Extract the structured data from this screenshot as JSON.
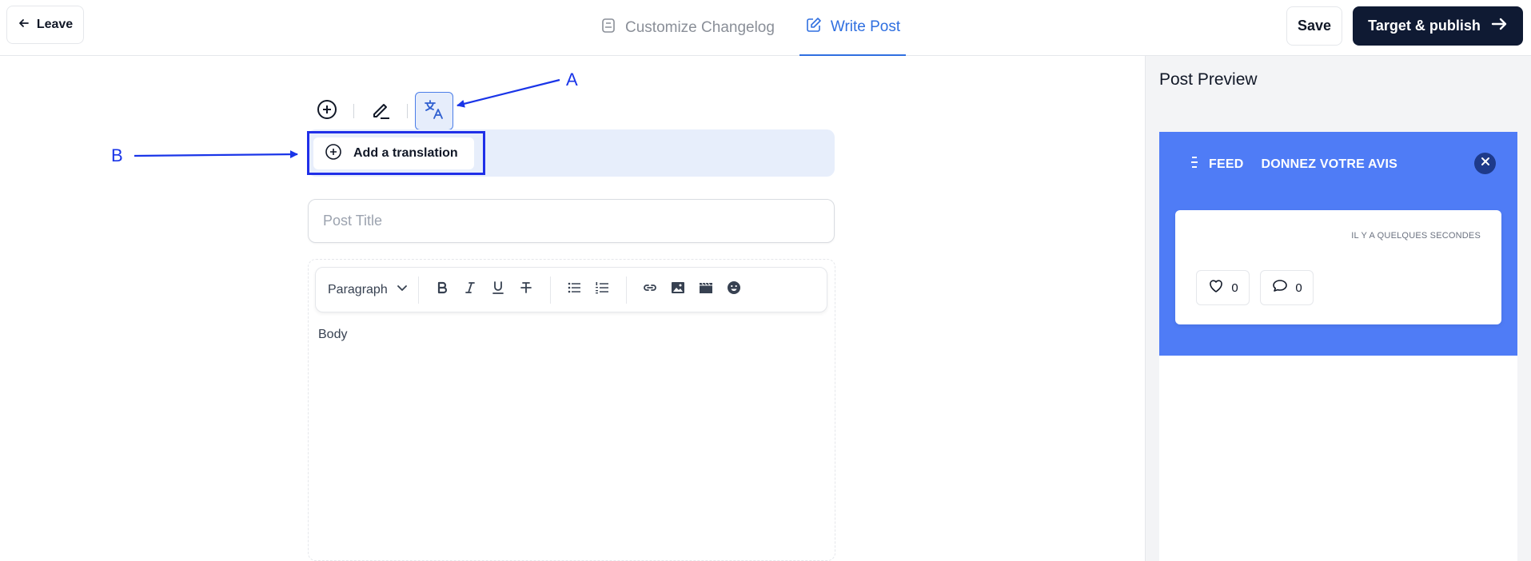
{
  "header": {
    "leave_label": "Leave",
    "tabs": [
      {
        "label": "Customize Changelog",
        "active": false
      },
      {
        "label": "Write Post",
        "active": true
      }
    ],
    "save_label": "Save",
    "publish_label": "Target & publish"
  },
  "editor": {
    "add_translation_label": "Add a translation",
    "title_placeholder": "Post Title",
    "paragraph_select": "Paragraph",
    "body_placeholder": "Body",
    "format_tools": [
      "bold-icon",
      "italic-icon",
      "underline-icon",
      "strikethrough-icon",
      "bullet-list-icon",
      "numbered-list-icon",
      "link-icon",
      "image-icon",
      "video-icon",
      "emoji-icon"
    ]
  },
  "annotations": {
    "a": "A",
    "b": "B",
    "color": "#1a35e8"
  },
  "preview": {
    "title": "Post Preview",
    "nav_feed": "FEED",
    "nav_feedback": "DONNEZ VOTRE AVIS",
    "post_time": "IL Y A QUELQUES SECONDES",
    "likes": "0",
    "comments": "0",
    "accent": "#4f7cf6"
  },
  "colors": {
    "primary_dark": "#0f1a33",
    "active_tab": "#2f6fe0",
    "translation_bar": "#e7eefb"
  }
}
